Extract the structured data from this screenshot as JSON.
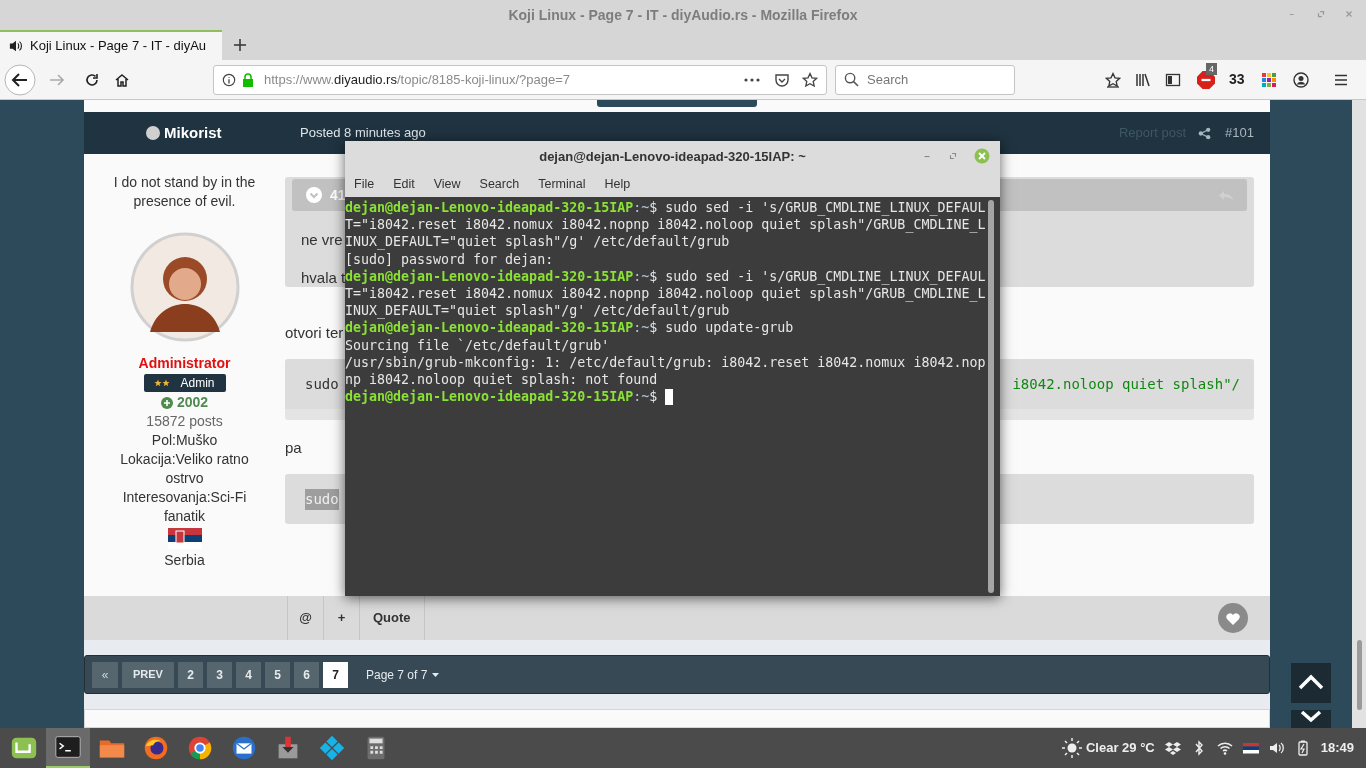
{
  "window": {
    "title": "Koji Linux - Page 7 - IT - diyAudio.rs - Mozilla Firefox"
  },
  "tabs": [
    {
      "label": "Koji Linux - Page 7 - IT - diyAu",
      "selected": true,
      "playing": true
    }
  ],
  "toolbar": {
    "url_prefix": "https://www.",
    "url_host": "diyaudio.rs",
    "url_path": "/topic/8185-koji-linux/?page=7",
    "search_placeholder": "Search",
    "adblock_count": "4",
    "counter": "33"
  },
  "post": {
    "author": "Mikorist",
    "posted": "Posted 8 minutes ago",
    "report": "Report post",
    "number": "#101",
    "signature": "I do not stand by in the presence of evil.",
    "role": "Administrator",
    "badge": "Admin",
    "stars": 2,
    "reputation": "2002",
    "posts": "15872 posts",
    "fields": [
      "Pol:Muško",
      "Lokacija:Veliko ratno ostrvo",
      "Interesovanja:Sci-Fi fanatik"
    ],
    "country": "Serbia",
    "quote": {
      "count": "41",
      "lines": [
        "ne vre",
        "hvala t"
      ]
    },
    "content": [
      {
        "kind": "text",
        "text": "otvori ter"
      },
      {
        "kind": "code",
        "text": "sudo",
        "tail": "i8042.noloop quiet splash\"/",
        "highlighted": false
      },
      {
        "kind": "text",
        "text": "pa"
      },
      {
        "kind": "code",
        "text": "sudo",
        "highlighted": true
      }
    ],
    "actions": [
      "@",
      "+",
      "Quote"
    ]
  },
  "pagination": {
    "first": "«",
    "prev": "PREV",
    "pages": [
      {
        "label": "2",
        "selected": false
      },
      {
        "label": "3",
        "selected": false
      },
      {
        "label": "4",
        "selected": false
      },
      {
        "label": "5",
        "selected": false
      },
      {
        "label": "6",
        "selected": false
      },
      {
        "label": "7",
        "selected": true
      }
    ],
    "summary": "Page 7 of 7"
  },
  "terminal": {
    "title": "dejan@dejan-Lenovo-ideapad-320-15IAP: ~",
    "menu": [
      "File",
      "Edit",
      "View",
      "Search",
      "Terminal",
      "Help"
    ],
    "lines": [
      {
        "kind": "prompt",
        "host": "dejan@dejan-Lenovo-ideapad-320-15IAP",
        "path": ":~",
        "command": "$ sudo sed -i 's/GRUB_CMDLINE_LINUX_DEFAUL"
      },
      {
        "kind": "output",
        "text": "T=\"i8042.reset i8042.nomux i8042.nopnp i8042.noloop quiet splash\"/GRUB_CMDLINE_L"
      },
      {
        "kind": "output",
        "text": "INUX_DEFAULT=\"quiet splash\"/g' /etc/default/grub"
      },
      {
        "kind": "output",
        "text": "[sudo] password for dejan:"
      },
      {
        "kind": "prompt",
        "host": "dejan@dejan-Lenovo-ideapad-320-15IAP",
        "path": ":~",
        "command": "$ sudo sed -i 's/GRUB_CMDLINE_LINUX_DEFAUL"
      },
      {
        "kind": "output",
        "text": "T=\"i8042.reset i8042.nomux i8042.nopnp i8042.noloop quiet splash\"/GRUB_CMDLINE_L"
      },
      {
        "kind": "output",
        "text": "INUX_DEFAULT=\"quiet splash\"/g' /etc/default/grub"
      },
      {
        "kind": "prompt",
        "host": "dejan@dejan-Lenovo-ideapad-320-15IAP",
        "path": ":~",
        "command": "$ sudo update-grub"
      },
      {
        "kind": "output",
        "text": "Sourcing file `/etc/default/grub'"
      },
      {
        "kind": "output",
        "text": "/usr/sbin/grub-mkconfig: 1: /etc/default/grub: i8042.reset i8042.nomux i8042.nop"
      },
      {
        "kind": "output",
        "text": "np i8042.noloop quiet splash: not found"
      },
      {
        "kind": "prompt",
        "host": "dejan@dejan-Lenovo-ideapad-320-15IAP",
        "path": ":~",
        "command": "$",
        "cursor": true
      }
    ]
  },
  "taskbar": {
    "apps": [
      {
        "kind": "menu",
        "active": false
      },
      {
        "kind": "terminal",
        "active": true
      },
      {
        "kind": "files",
        "active": false
      },
      {
        "kind": "firefox",
        "active": false
      },
      {
        "kind": "chrome",
        "active": false
      },
      {
        "kind": "mail",
        "active": false
      },
      {
        "kind": "installer",
        "active": false
      },
      {
        "kind": "kodi",
        "active": false
      },
      {
        "kind": "calculator",
        "active": false
      }
    ],
    "weather": "Clear 29 °C",
    "clock": "18:49"
  }
}
